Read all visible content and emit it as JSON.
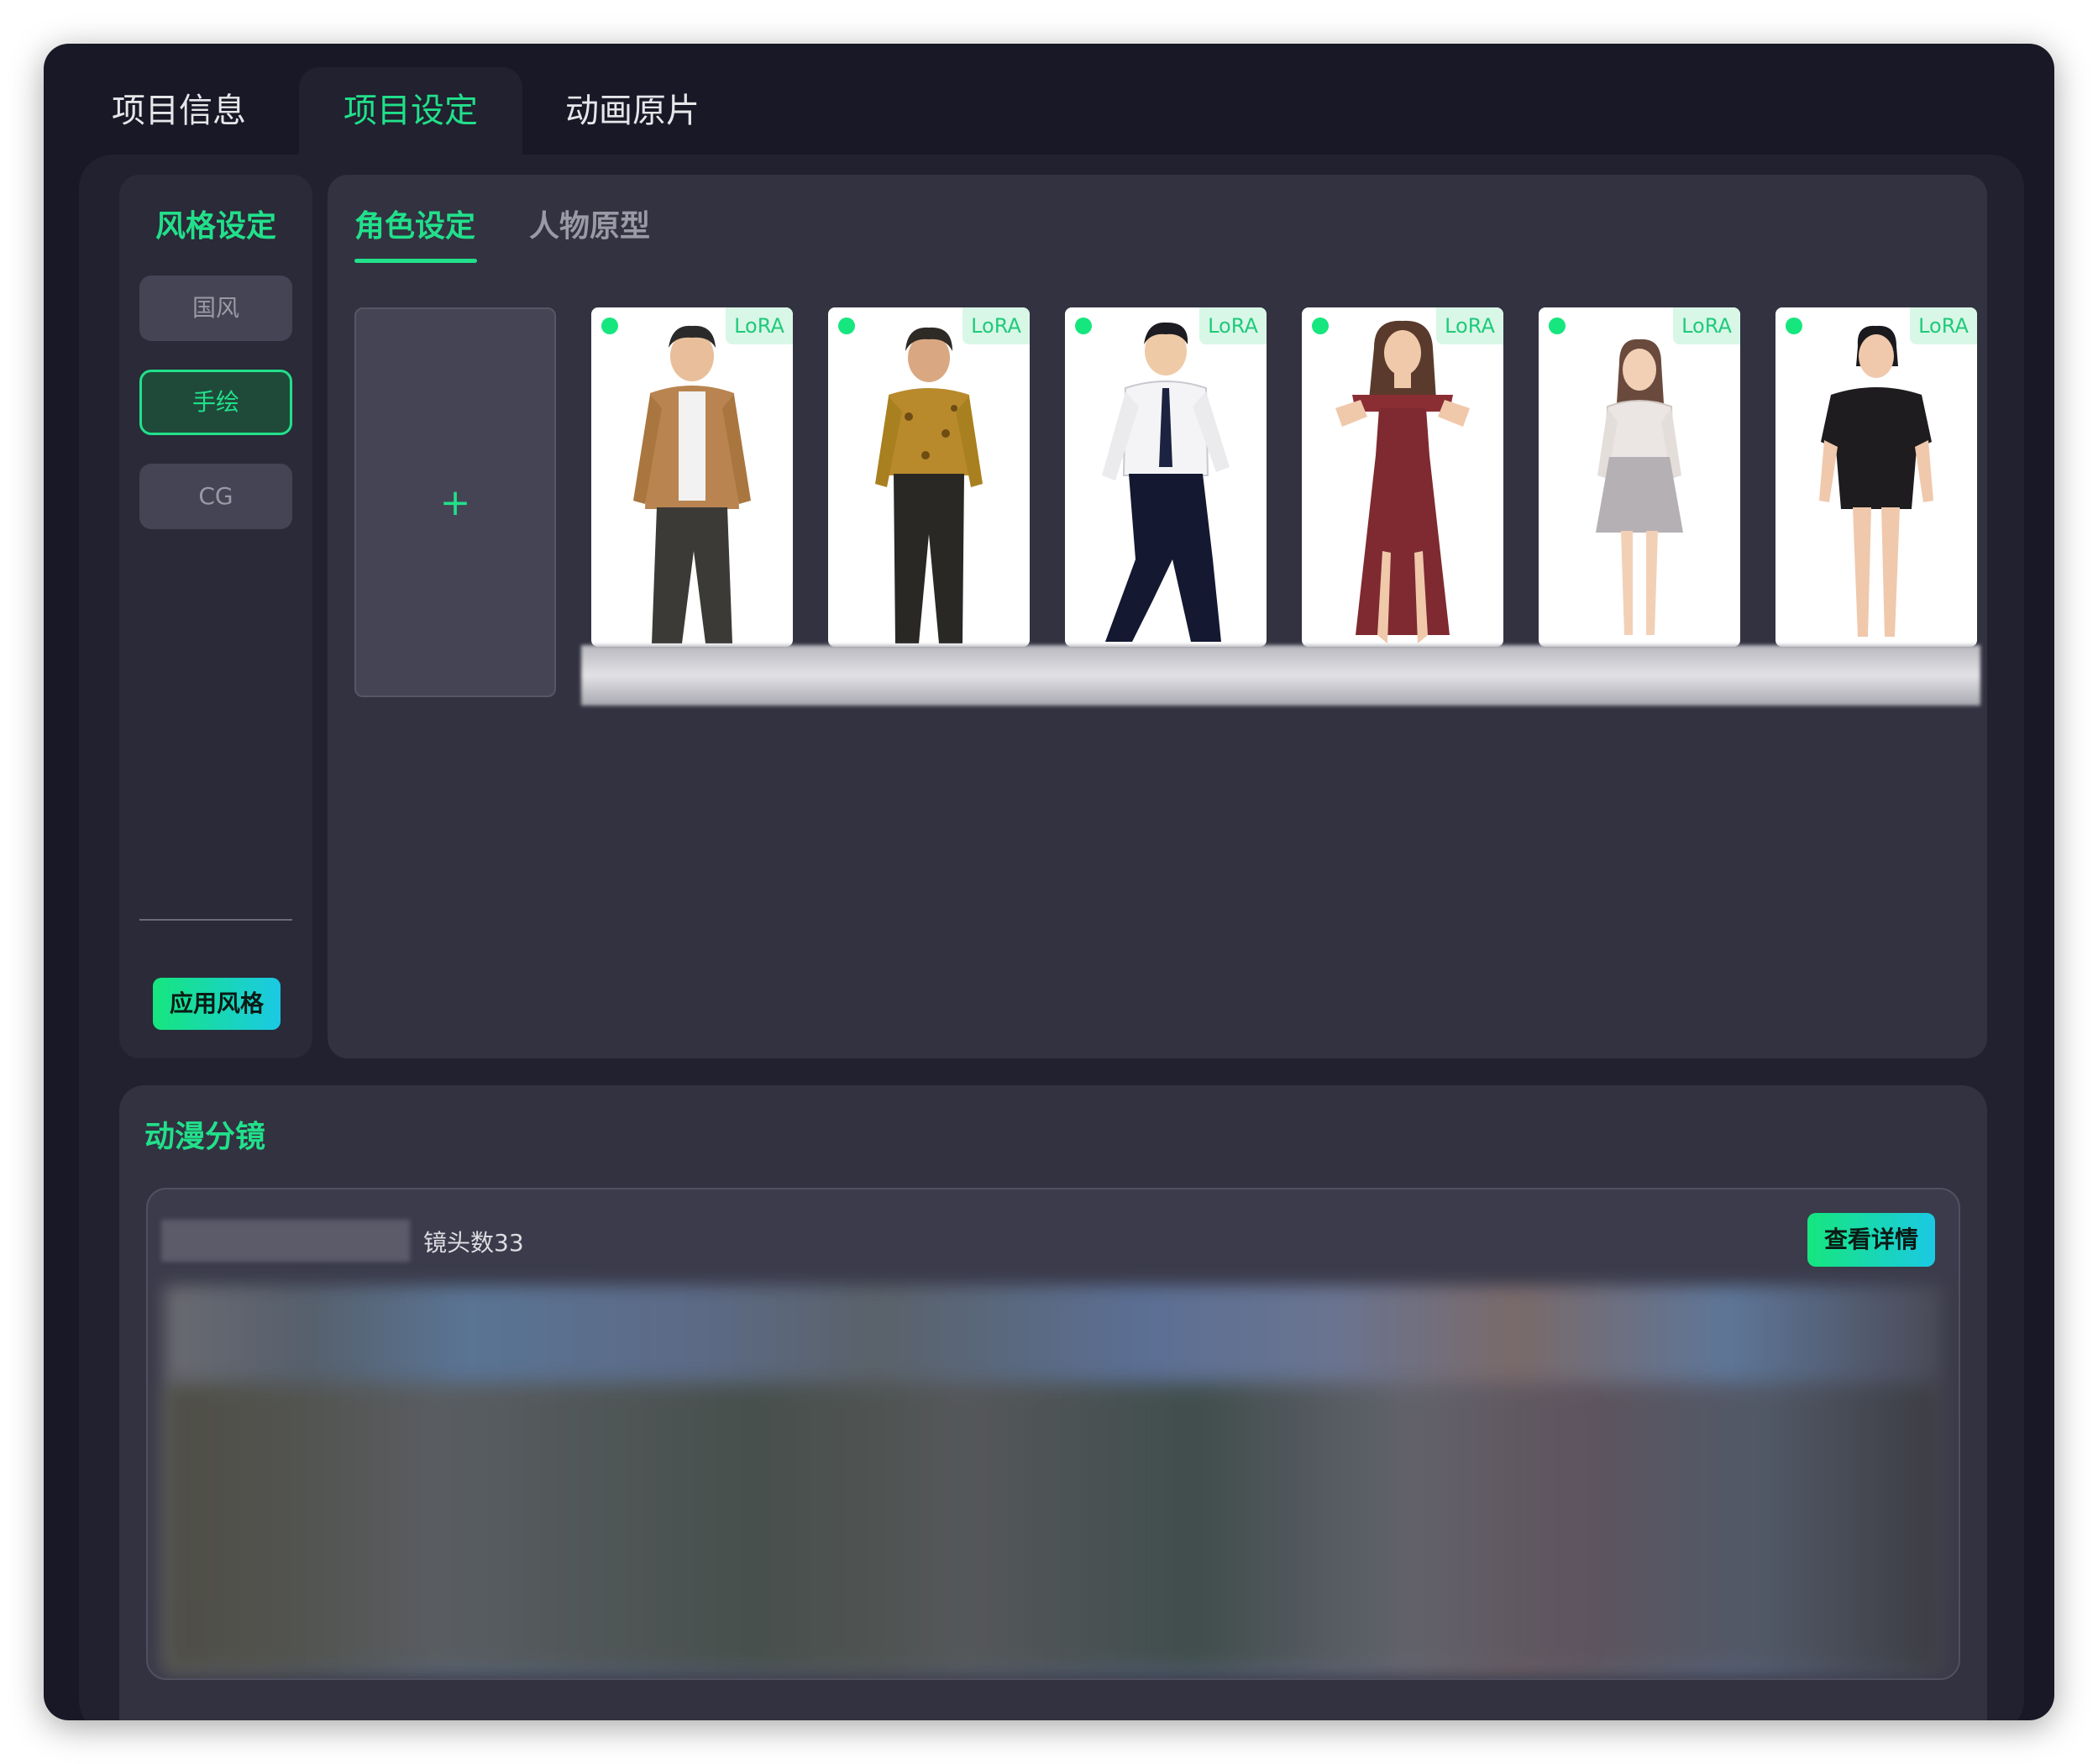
{
  "top_tabs": [
    "项目信息",
    "项目设定",
    "动画原片"
  ],
  "active_top_tab": "项目设定",
  "style_panel": {
    "title": "风格设定",
    "options": [
      "国风",
      "手绘",
      "CG"
    ],
    "selected": "手绘",
    "apply_label": "应用风格"
  },
  "character_panel": {
    "tabs": [
      "角色设定",
      "人物原型"
    ],
    "active_tab": "角色设定",
    "add_symbol": "+",
    "cards": [
      {
        "badge": "LoRA",
        "status": "active"
      },
      {
        "badge": "LoRA",
        "status": "active"
      },
      {
        "badge": "LoRA",
        "status": "active"
      },
      {
        "badge": "LoRA",
        "status": "active"
      },
      {
        "badge": "LoRA",
        "status": "active"
      },
      {
        "badge": "LoRA",
        "status": "active"
      }
    ]
  },
  "storyboard": {
    "title": "动漫分镜",
    "shot_count_label": "镜头数33",
    "detail_button": "查看详情"
  },
  "colors": {
    "accent": "#21e08a",
    "window_bg": "#181826",
    "panel_bg": "#323241",
    "button_gradient_start": "#16e67e",
    "button_gradient_end": "#1bc9e4"
  }
}
